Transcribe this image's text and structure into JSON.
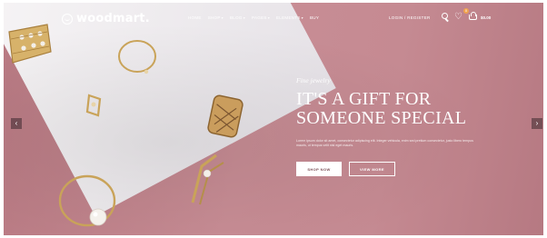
{
  "brand": {
    "name": "woodmart."
  },
  "nav": {
    "items": [
      {
        "label": "HOME"
      },
      {
        "label": "SHOP"
      },
      {
        "label": "BLOG"
      },
      {
        "label": "PAGES"
      },
      {
        "label": "ELEMENTS"
      },
      {
        "label": "BUY"
      }
    ],
    "login_label": "LOGIN / REGISTER",
    "wishlist_count": "0",
    "cart_total": "$0.00"
  },
  "hero": {
    "eyebrow": "Fine jewelry",
    "title_line1": "IT'S A GIFT FOR",
    "title_line2": "SOMEONE SPECIAL",
    "description": "Lorem ipsum dolor sit amet, consectetur adipiscing elit. Integer vehicula, enim sed pretium consectetur, justo libero tempus mauris, ut tempus velit nisl eget mauris.",
    "primary_button": "SHOP NOW",
    "secondary_button": "VIEW MORE"
  },
  "slider": {
    "prev_label": "‹",
    "next_label": "›"
  },
  "colors": {
    "background": "#c4868e",
    "accent": "#f0a24f",
    "text": "#ffffff"
  }
}
